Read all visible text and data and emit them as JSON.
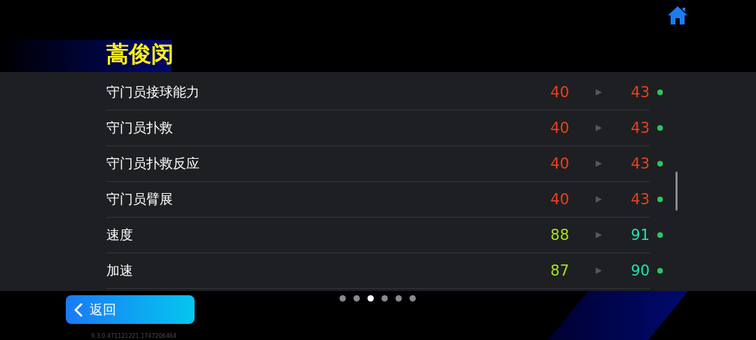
{
  "title": "蒿俊闵",
  "rows": [
    {
      "name": "守门员接球能力",
      "current": {
        "value": "40",
        "color": "#e8421c"
      },
      "next": {
        "value": "43",
        "color": "#e8421c"
      }
    },
    {
      "name": "守门员扑救",
      "current": {
        "value": "40",
        "color": "#e8421c"
      },
      "next": {
        "value": "43",
        "color": "#e8421c"
      }
    },
    {
      "name": "守门员扑救反应",
      "current": {
        "value": "40",
        "color": "#e8421c"
      },
      "next": {
        "value": "43",
        "color": "#e8421c"
      }
    },
    {
      "name": "守门员臂展",
      "current": {
        "value": "40",
        "color": "#e8421c"
      },
      "next": {
        "value": "43",
        "color": "#e8421c"
      }
    },
    {
      "name": "速度",
      "current": {
        "value": "88",
        "color": "#a4e31f"
      },
      "next": {
        "value": "91",
        "color": "#1fe3b0"
      }
    },
    {
      "name": "加速",
      "current": {
        "value": "87",
        "color": "#a4e31f"
      },
      "next": {
        "value": "90",
        "color": "#1fe3b0"
      }
    }
  ],
  "pages": [
    {
      "selected": false
    },
    {
      "selected": false
    },
    {
      "selected": true
    },
    {
      "selected": false
    },
    {
      "selected": false
    },
    {
      "selected": false
    }
  ],
  "back_button": {
    "label": "返回"
  },
  "version": "9.3.0.471121221.1747206464"
}
